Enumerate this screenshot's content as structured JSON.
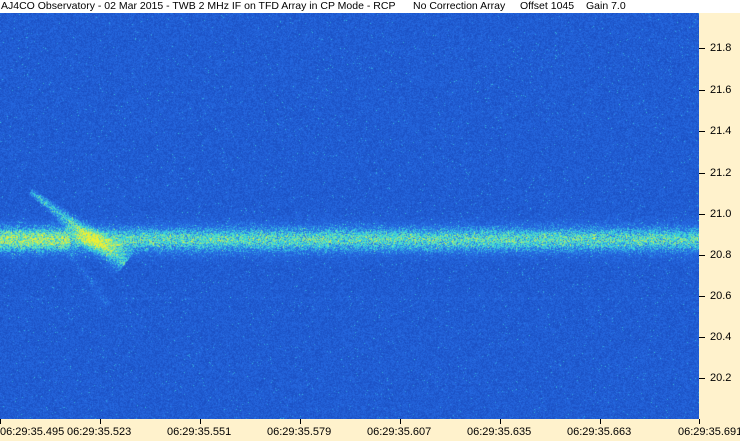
{
  "header": {
    "title": "AJ4CO Observatory - 02 Mar 2015 - TWB 2 MHz IF on TFD Array in CP Mode - RCP",
    "correction": "No Correction Array",
    "offset": "Offset 1045",
    "gain": "Gain 7.0"
  },
  "y_axis": {
    "labels": [
      "21.8",
      "21.6",
      "21.4",
      "21.2",
      "21.0",
      "20.8",
      "20.6",
      "20.4",
      "20.2"
    ],
    "values": [
      21.8,
      21.6,
      21.4,
      21.2,
      21.0,
      20.8,
      20.6,
      20.4,
      20.2
    ]
  },
  "x_axis": {
    "labels": [
      "06:29:35.495",
      "06:29:35.523",
      "06:29:35.551",
      "06:29:35.579",
      "06:29:35.607",
      "06:29:35.635",
      "06:29:35.663",
      "06:29:35.691"
    ]
  },
  "colors": {
    "background_blue": "#1a4fd0",
    "axis_background": "#fff2cc",
    "signal_yellow": "#e8ec40",
    "signal_cyan": "#40d8e0"
  }
}
